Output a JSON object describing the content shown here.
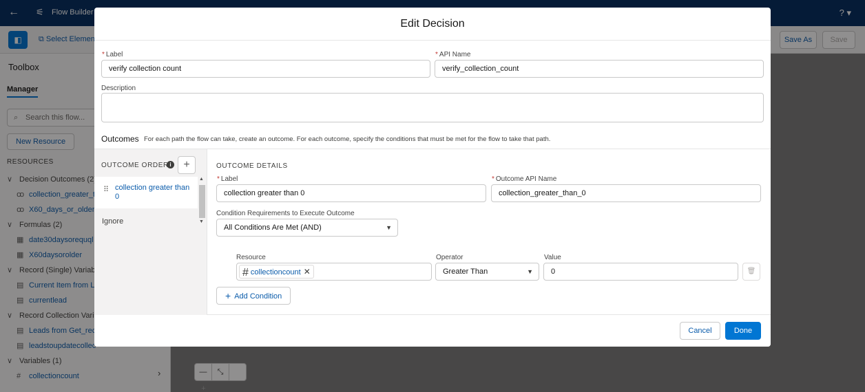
{
  "app": {
    "title": "Flow Builder",
    "help": "? ▾",
    "toolbar": {
      "select_elements": "Select Elemen",
      "save_as": "Save As",
      "save": "Save"
    }
  },
  "sidebar": {
    "toolbox": "Toolbox",
    "manager_tab": "Manager",
    "search_placeholder": "Search this flow...",
    "new_resource": "New Resource",
    "resources_heading": "RESOURCES",
    "items": [
      {
        "type": "group",
        "label": "Decision Outcomes (2)"
      },
      {
        "type": "leaf",
        "icon": "outcome-icon",
        "label": "collection_greater_th"
      },
      {
        "type": "leaf",
        "icon": "outcome-icon",
        "label": "X60_days_or_older"
      },
      {
        "type": "group",
        "label": "Formulas (2)"
      },
      {
        "type": "leaf",
        "icon": "calendar-icon",
        "label": "date30daysorequql"
      },
      {
        "type": "leaf",
        "icon": "calendar-icon",
        "label": "X60daysorolder"
      },
      {
        "type": "group",
        "label": "Record (Single) Variable"
      },
      {
        "type": "leaf",
        "icon": "record-icon",
        "label": "Current Item from Le"
      },
      {
        "type": "leaf",
        "icon": "record-icon",
        "label": "currentlead"
      },
      {
        "type": "group",
        "label": "Record Collection Varia"
      },
      {
        "type": "leaf",
        "icon": "record-icon",
        "label": "Leads from Get_reco"
      },
      {
        "type": "leaf",
        "icon": "record-icon",
        "label": "leadstoupdatecollec"
      },
      {
        "type": "group",
        "label": "Variables (1)"
      },
      {
        "type": "leaf",
        "icon": "number-icon",
        "label": "collectioncount"
      }
    ]
  },
  "zoom": {
    "minus": "—",
    "fit": "⤡",
    "plus": "+"
  },
  "modal": {
    "title": "Edit Decision",
    "label_label": "Label",
    "label_value": "verify collection count",
    "api_label": "API Name",
    "api_value": "verify_collection_count",
    "description_label": "Description",
    "description_value": "",
    "outcomes_title": "Outcomes",
    "outcomes_desc": "For each path the flow can take, create an outcome. For each outcome, specify the conditions that must be met for the flow to take that path.",
    "outcome_order": {
      "heading": "OUTCOME ORDER",
      "items": [
        "collection greater than 0",
        "Ignore"
      ]
    },
    "details": {
      "heading": "OUTCOME DETAILS",
      "label_label": "Label",
      "label_value": "collection greater than 0",
      "api_label": "Outcome API Name",
      "api_value": "collection_greater_than_0",
      "condition_req_label": "Condition Requirements to Execute Outcome",
      "condition_req_value": "All Conditions Are Met (AND)",
      "condition": {
        "resource_label": "Resource",
        "resource_value": "collectioncount",
        "operator_label": "Operator",
        "operator_value": "Greater Than",
        "value_label": "Value",
        "value_value": "0"
      },
      "add_condition": "Add Condition"
    },
    "cancel": "Cancel",
    "done": "Done"
  }
}
